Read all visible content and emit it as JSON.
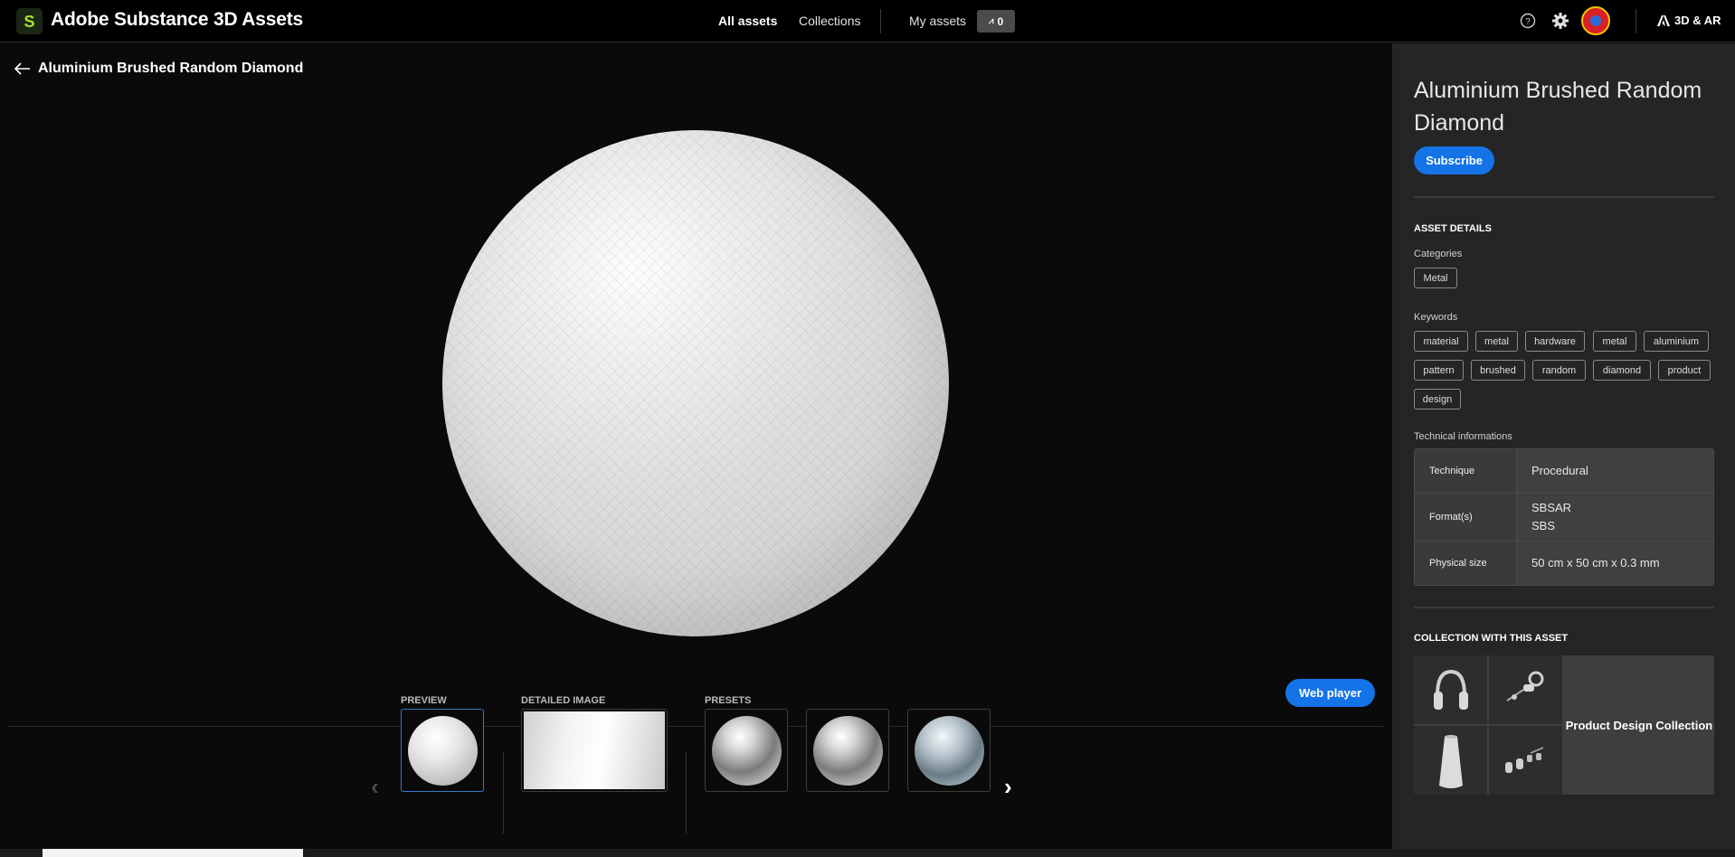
{
  "header": {
    "app_title": "Adobe Substance 3D Assets",
    "nav": {
      "all_assets": "All assets",
      "collections": "Collections",
      "my_assets": "My assets"
    },
    "credits": "0",
    "app_switcher": "3D & AR",
    "icons": [
      "help-icon",
      "gear-icon",
      "adobe-logo-icon"
    ]
  },
  "viewer": {
    "back_title": "Aluminium Brushed Random Diamond",
    "web_player_label": "Web player",
    "strip": {
      "preview_label": "PREVIEW",
      "detailed_label": "DETAILED IMAGE",
      "presets_label": "PRESETS"
    }
  },
  "panel": {
    "title": "Aluminium Brushed Random Diamond",
    "subscribe_label": "Subscribe",
    "asset_details_heading": "ASSET DETAILS",
    "categories_heading": "Categories",
    "categories": [
      "Metal"
    ],
    "keywords_heading": "Keywords",
    "keywords": [
      "material",
      "metal",
      "hardware",
      "metal",
      "aluminium",
      "pattern",
      "brushed",
      "random",
      "diamond",
      "product",
      "design"
    ],
    "technical_heading": "Technical informations",
    "technical": {
      "technique_label": "Technique",
      "technique_value": "Procedural",
      "formats_label": "Format(s)",
      "formats": [
        "SBSAR",
        "SBS"
      ],
      "physical_label": "Physical size",
      "physical_value": "50 cm x 50 cm x 0.3 mm"
    },
    "collection_heading": "COLLECTION WITH THIS ASSET",
    "collection_name": "Product Design Collection"
  },
  "colors": {
    "accent": "#1473e6",
    "logo_green": "#a6e22e"
  }
}
